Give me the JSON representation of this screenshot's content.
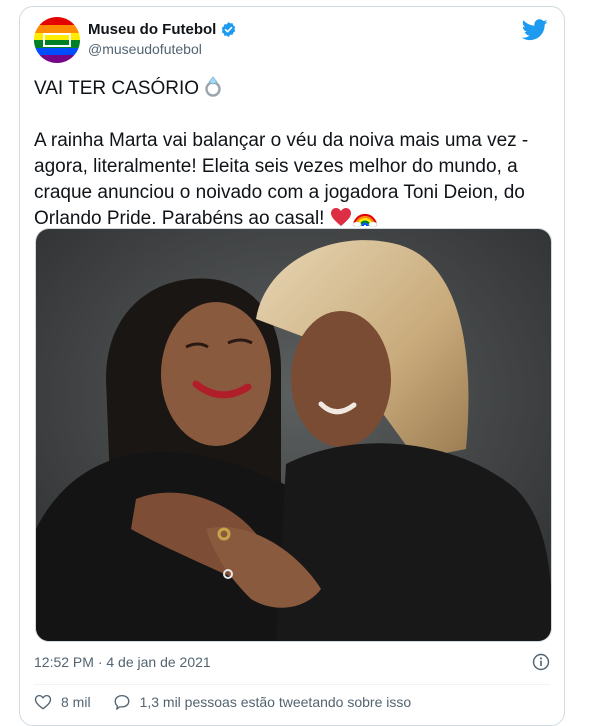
{
  "account": {
    "name": "Museu do Futebol",
    "handle": "@museudofutebol"
  },
  "tweet": {
    "line1": "VAI TER CASÓRIO",
    "line2": "A rainha Marta vai balançar o véu da noiva mais uma vez -\nagora, literalmente! Eleita seis vezes melhor do mundo, a\ncraque anunciou o noivado com a jogadora Toni Deion, do\nOrlando Pride. Parabéns ao casal!"
  },
  "meta": {
    "timestamp": "12:52 PM · 4 de jan de 2021"
  },
  "actions": {
    "likes": "8 mil",
    "conversation": "1,3 mil pessoas estão tweetando sobre isso"
  },
  "icons": {
    "verified": "verified-badge-icon",
    "bird": "twitter-bird-icon",
    "ring": "ring-emoji",
    "heart": "red-heart-emoji",
    "rainbow": "rainbow-emoji",
    "info": "info-icon",
    "like": "heart-outline-icon",
    "reply": "speech-bubble-icon"
  },
  "colors": {
    "brand_blue": "#1d9bf0",
    "text_secondary": "#536471",
    "border": "#cfd9de"
  }
}
